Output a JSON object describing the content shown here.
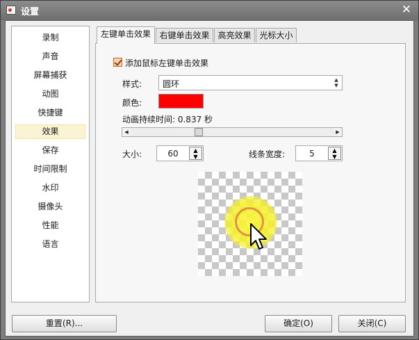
{
  "window": {
    "title": "设置",
    "close_glyph": "✕",
    "app_icon": "app-icon"
  },
  "sidebar": {
    "items": [
      {
        "label": "录制"
      },
      {
        "label": "声音"
      },
      {
        "label": "屏幕捕获"
      },
      {
        "label": "动图"
      },
      {
        "label": "快捷键"
      },
      {
        "label": "效果",
        "selected": true
      },
      {
        "label": "保存"
      },
      {
        "label": "时间限制"
      },
      {
        "label": "水印"
      },
      {
        "label": "摄像头"
      },
      {
        "label": "性能"
      },
      {
        "label": "语言"
      }
    ]
  },
  "tabs": [
    {
      "label": "左键单击效果",
      "active": true
    },
    {
      "label": "右键单击效果"
    },
    {
      "label": "高亮效果"
    },
    {
      "label": "光标大小"
    }
  ],
  "effect": {
    "enable_label": "添加鼠标左键单击效果",
    "enabled": true,
    "style_label": "样式:",
    "style_value": "圆环",
    "color_label": "颜色:",
    "color_value": "#ff0000",
    "duration_label": "动画持续时间: 0.837 秒",
    "duration_fraction": 0.33,
    "size_label": "大小:",
    "size_value": "60",
    "line_width_label": "线条宽度:",
    "line_width_value": "5"
  },
  "preview": {
    "glow_color": "#f5f03a",
    "ring_color": "#e07a3c",
    "cursor_icon": "arrow-cursor-icon"
  },
  "buttons": {
    "reset": "重置(R)...",
    "ok": "确定(O)",
    "close": "关闭(C)"
  }
}
